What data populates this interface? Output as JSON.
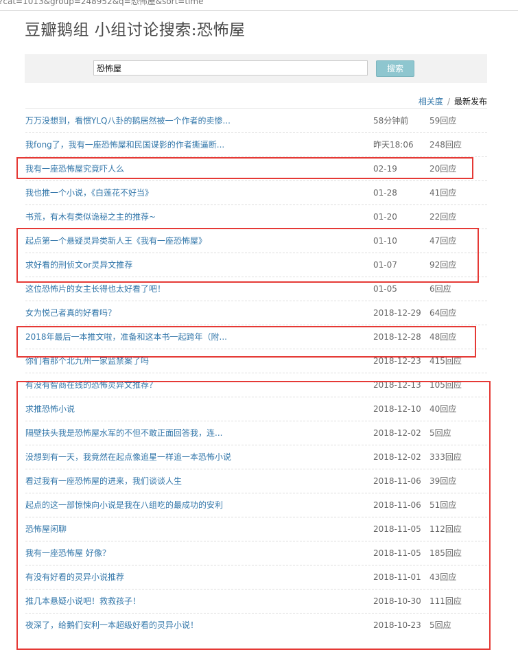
{
  "browser": {
    "url": "?cat=1013&group=248952&q=恐怖屋&sort=time"
  },
  "page": {
    "title": "豆瓣鹅组 小组讨论搜索:恐怖屋"
  },
  "search": {
    "value": "恐怖屋",
    "button_label": "搜索"
  },
  "sort": {
    "relevance_label": "相关度",
    "separator": "/",
    "latest_label": "最新发布"
  },
  "results": [
    {
      "title": "万万没想到，看惯YLQ八卦的鹅居然被一个作者的卖惨...",
      "time": "58分钟前",
      "replies": "59回应"
    },
    {
      "title": "我fong了，我有一座恐怖屋和民国谍影的作者撕逼断...",
      "time": "昨天18:06",
      "replies": "248回应"
    },
    {
      "title": "我有一座恐怖屋究竟吓人么",
      "time": "02-19",
      "replies": "20回应"
    },
    {
      "title": "我也推一个小说，《白莲花不好当》",
      "time": "01-28",
      "replies": "41回应"
    },
    {
      "title": "书荒，有木有类似诡秘之主的推荐~",
      "time": "01-20",
      "replies": "22回应"
    },
    {
      "title": "起点第一个悬疑灵异类新人王《我有一座恐怖屋》",
      "time": "01-10",
      "replies": "47回应"
    },
    {
      "title": "求好看的刑侦文or灵异文推荐",
      "time": "01-07",
      "replies": "92回应"
    },
    {
      "title": "这位恐怖片的女主长得也太好看了吧！",
      "time": "01-05",
      "replies": "6回应"
    },
    {
      "title": "女为悦己者真的好看吗？",
      "time": "2018-12-29",
      "replies": "64回应"
    },
    {
      "title": "2018年最后一本推文啦，准备和这本书一起跨年（附...",
      "time": "2018-12-28",
      "replies": "48回应"
    },
    {
      "title": "你们看那个北九州一家监禁案了吗",
      "time": "2018-12-23",
      "replies": "415回应"
    },
    {
      "title": "有没有智商在线的恐怖灵异文推荐？",
      "time": "2018-12-13",
      "replies": "105回应"
    },
    {
      "title": "求推恐怖小说",
      "time": "2018-12-10",
      "replies": "40回应"
    },
    {
      "title": "隔壁扶头我是恐怖屋水军的不但不敢正面回答我，连...",
      "time": "2018-12-02",
      "replies": "5回应"
    },
    {
      "title": "没想到有一天，我竟然在起点像追星一样追一本恐怖小说",
      "time": "2018-12-02",
      "replies": "333回应"
    },
    {
      "title": "看过我有一座恐怖屋的进来，我们谈谈人生",
      "time": "2018-11-06",
      "replies": "39回应"
    },
    {
      "title": "起点的这一部惊悚向小说是我在八组吃的最成功的安利",
      "time": "2018-11-06",
      "replies": "51回应"
    },
    {
      "title": "恐怖屋闲聊",
      "time": "2018-11-05",
      "replies": "112回应"
    },
    {
      "title": "我有一座恐怖屋 好像？",
      "time": "2018-11-05",
      "replies": "185回应"
    },
    {
      "title": "有没有好看的灵异小说推荐",
      "time": "2018-11-01",
      "replies": "43回应"
    },
    {
      "title": "推几本悬疑小说吧！救救孩子！",
      "time": "2018-10-30",
      "replies": "111回应"
    },
    {
      "title": "夜深了，给鹅们安利一本超级好看的灵异小说！",
      "time": "2018-10-23",
      "replies": "5回应"
    }
  ],
  "annotations": {
    "highlight_color": "#e53935",
    "link_color": "#3377aa",
    "search_button_color": "#8ec6cf"
  }
}
